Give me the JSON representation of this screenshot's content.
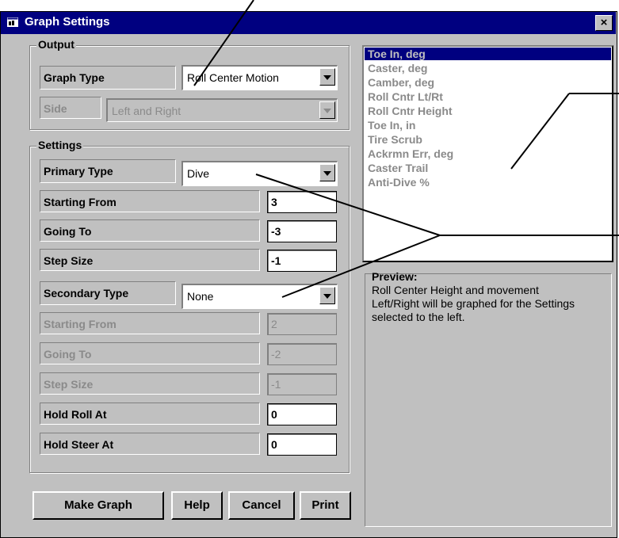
{
  "window": {
    "title": "Graph Settings",
    "close": "×"
  },
  "output": {
    "group_label": "Output",
    "graph_type_label": "Graph Type",
    "graph_type_value": "Roll Center Motion",
    "side_label": "Side",
    "side_value": "Left and Right"
  },
  "settings": {
    "group_label": "Settings",
    "primary_type_label": "Primary Type",
    "primary_type_value": "Dive",
    "primary_rows": [
      {
        "label": "Starting From",
        "value": "3"
      },
      {
        "label": "Going To",
        "value": "-3"
      },
      {
        "label": "Step Size",
        "value": "-1"
      }
    ],
    "secondary_type_label": "Secondary Type",
    "secondary_type_value": "None",
    "secondary_rows": [
      {
        "label": "Starting From",
        "value": "2"
      },
      {
        "label": "Going To",
        "value": "-2"
      },
      {
        "label": "Step Size",
        "value": "-1"
      }
    ],
    "hold_rows": [
      {
        "label": "Hold Roll At",
        "value": "0"
      },
      {
        "label": "Hold Steer At",
        "value": "0"
      }
    ]
  },
  "buttons": {
    "make_graph": "Make Graph",
    "help": "Help",
    "cancel": "Cancel",
    "print": "Print"
  },
  "list": {
    "items": [
      "Toe In, deg",
      "Caster, deg",
      "Camber, deg",
      "Roll Cntr Lt/Rt",
      "Roll Cntr Height",
      "Toe In, in",
      "Tire Scrub",
      "Ackrmn Err, deg",
      "Caster Trail",
      "Anti-Dive %"
    ],
    "selected_index": 0
  },
  "preview": {
    "title": "Preview:",
    "text": "Roll Center Height and movement Left/Right will be graphed for the Settings selected to the left."
  },
  "colors": {
    "titlebar": "#000080",
    "face": "#c0c0c0",
    "disabled_text": "#8a8a8a"
  }
}
